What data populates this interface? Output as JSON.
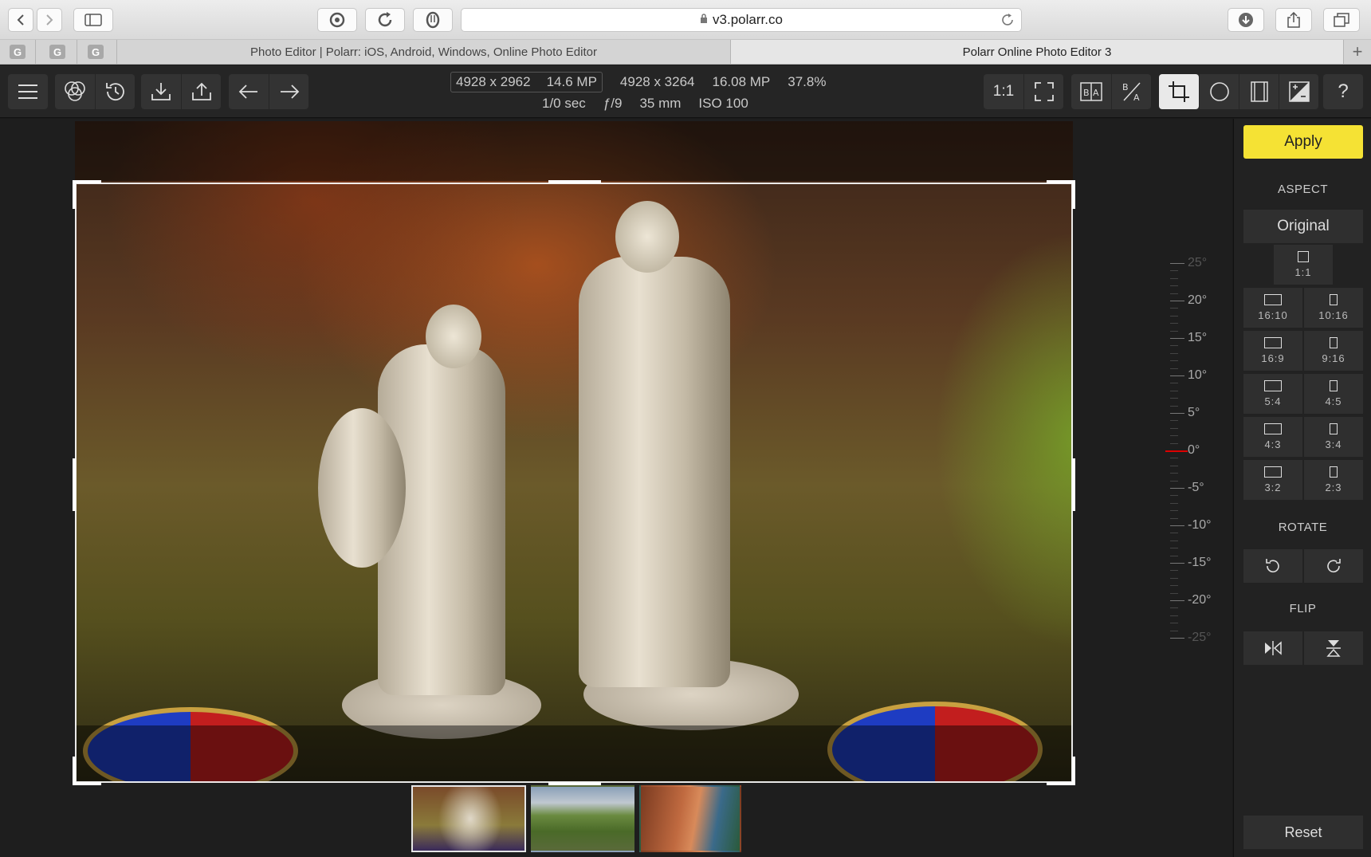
{
  "browser": {
    "url": "v3.polarr.co",
    "tabs": [
      {
        "title": "Photo Editor | Polarr: iOS, Android, Windows, Online Photo Editor",
        "active": false
      },
      {
        "title": "Polarr Online Photo Editor 3",
        "active": true
      }
    ],
    "pinned": [
      "G",
      "G",
      "G"
    ],
    "new_tab": "+"
  },
  "toolbar": {
    "crop_dims": "4928 x 2962",
    "crop_mp": "14.6 MP",
    "orig_dims": "4928 x 3264",
    "orig_mp": "16.08 MP",
    "zoom": "37.8%",
    "shutter": "1/0 sec",
    "aperture": "ƒ/9",
    "focal": "35 mm",
    "iso": "ISO 100",
    "actual_size": "1:1",
    "help": "?"
  },
  "ruler": {
    "labels": [
      "25°",
      "20°",
      "15°",
      "10°",
      "5°",
      "0°",
      "-5°",
      "-10°",
      "-15°",
      "-20°",
      "-25°"
    ],
    "angle_deg": 0
  },
  "panel": {
    "apply": "Apply",
    "aspect_heading": "ASPECT",
    "original": "Original",
    "ratios": [
      {
        "label": "1:1",
        "orient": "square"
      },
      {
        "label": "16:10",
        "orient": "landscape"
      },
      {
        "label": "10:16",
        "orient": "portrait"
      },
      {
        "label": "16:9",
        "orient": "landscape"
      },
      {
        "label": "9:16",
        "orient": "portrait"
      },
      {
        "label": "5:4",
        "orient": "landscape"
      },
      {
        "label": "4:5",
        "orient": "portrait"
      },
      {
        "label": "4:3",
        "orient": "landscape"
      },
      {
        "label": "3:4",
        "orient": "portrait"
      },
      {
        "label": "3:2",
        "orient": "landscape"
      },
      {
        "label": "2:3",
        "orient": "portrait"
      }
    ],
    "rotate_heading": "ROTATE",
    "flip_heading": "FLIP",
    "reset": "Reset"
  },
  "colors": {
    "accent": "#f5e234",
    "panel_bg": "#222222",
    "toolbar_bg": "#252525",
    "ruler_zero": "#dd0000"
  }
}
